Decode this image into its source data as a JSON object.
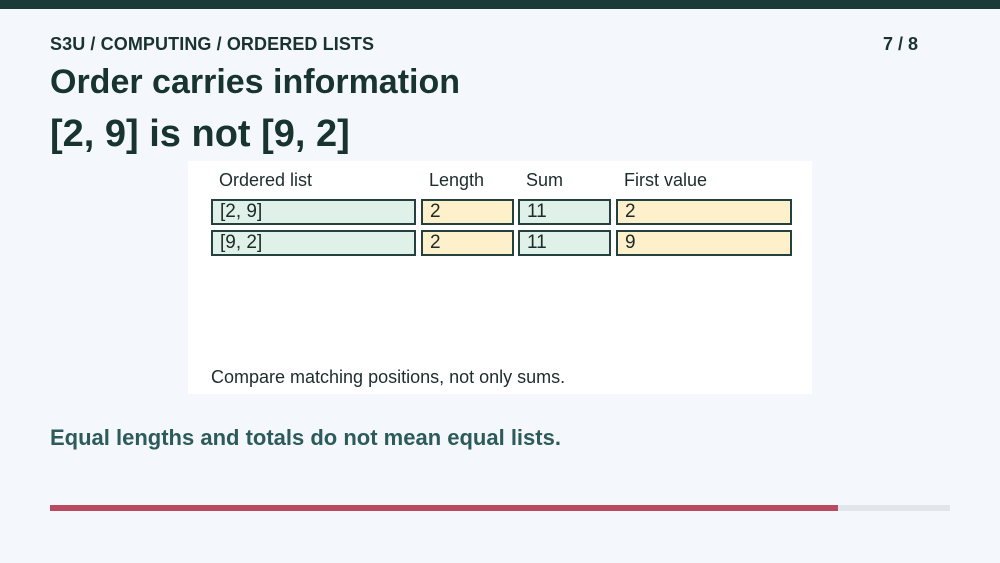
{
  "header": {
    "breadcrumb": "S3U / COMPUTING / ORDERED LISTS",
    "page_counter": "7 / 8"
  },
  "slide": {
    "title": "Order carries information",
    "subtitle": "[2, 9] is not [9, 2]",
    "caption": "Compare matching positions, not only sums.",
    "takeaway": "Equal lengths and totals do not mean equal lists."
  },
  "table": {
    "headers": [
      "Ordered list",
      "Length",
      "Sum",
      "First value"
    ],
    "rows": [
      [
        "[2, 9]",
        "2",
        "11",
        "2"
      ],
      [
        "[9, 2]",
        "2",
        "11",
        "9"
      ]
    ]
  },
  "progress": {
    "current": 7,
    "total": 8,
    "fraction": 0.875
  },
  "colors": {
    "top_bar": "#1a3b38",
    "progress_fill": "#b94a60",
    "progress_track": "#e1e6ea",
    "cell_green": "#e0f1ea",
    "cell_yellow": "#fdf0cb",
    "takeaway_text": "#2d5b5c"
  }
}
